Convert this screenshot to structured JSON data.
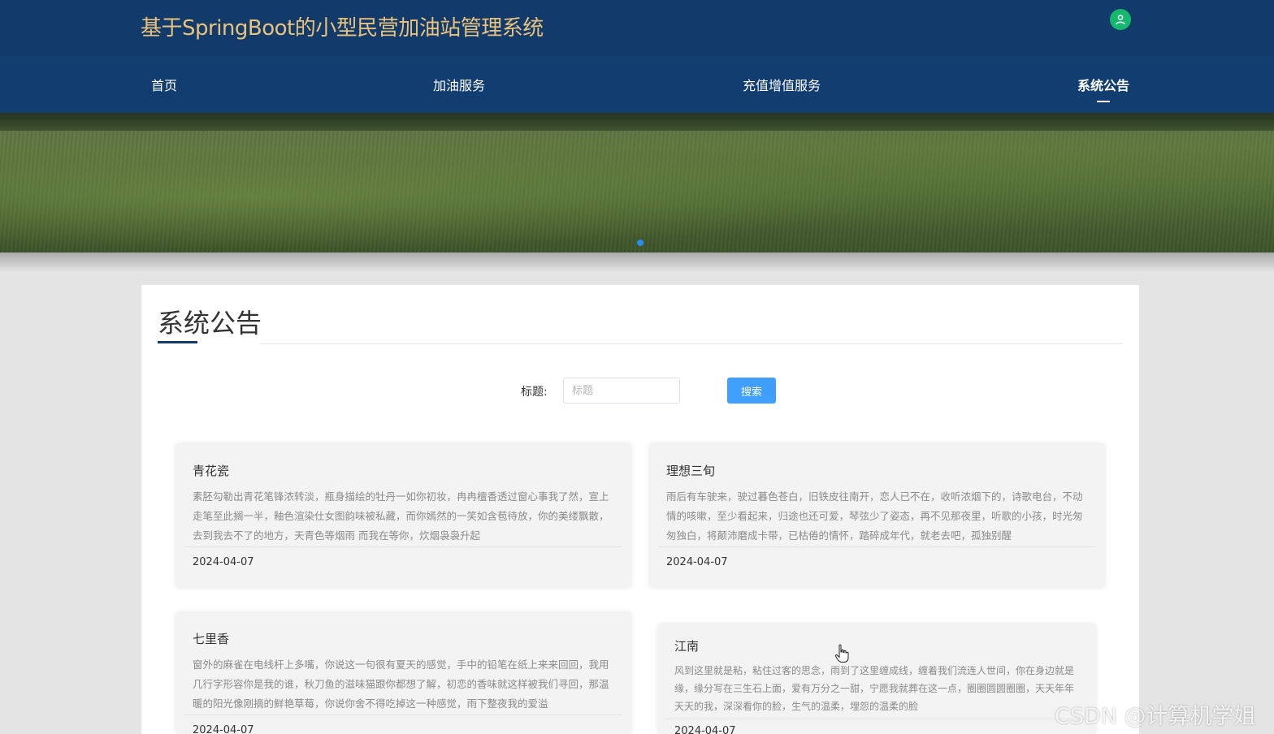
{
  "header": {
    "site_title": "基于SpringBoot的小型民营加油站管理系统",
    "user_icon": "user-icon"
  },
  "nav": {
    "items": [
      {
        "label": "首页"
      },
      {
        "label": "加油服务"
      },
      {
        "label": "充值增值服务"
      },
      {
        "label": "系统公告",
        "active": true
      }
    ]
  },
  "banner": {
    "active_slide": 1
  },
  "main": {
    "title": "系统公告",
    "search": {
      "label": "标题:",
      "placeholder": "标题",
      "value": "",
      "button_label": "搜索"
    },
    "cards": [
      {
        "title": "青花瓷",
        "body": "素胚勾勒出青花笔锋浓转淡，瓶身描绘的牡丹一如你初妆，冉冉檀香透过窗心事我了然，宣上走笔至此搁一半，釉色渲染仕女图韵味被私藏，而你嫣然的一笑如含苞待放，你的美缕飘散，去到我去不了的地方，天青色等烟雨 而我在等你，炊烟袅袅升起",
        "date": "2024-04-07"
      },
      {
        "title": "理想三旬",
        "body": "雨后有车驶来，驶过暮色苍白，旧铁皮往南开，恋人已不在，收听浓烟下的，诗歌电台，不动情的咳嗽，至少看起来，归途也还可爱，琴弦少了姿态，再不见那夜里，听歌的小孩，时光匆匆独白，将颠沛磨成卡带，已枯倦的情怀，踏碎成年代，就老去吧，孤独别醒",
        "date": "2024-04-07"
      },
      {
        "title": "七里香",
        "body": "窗外的麻雀在电线杆上多嘴，你说这一句很有夏天的感觉，手中的铅笔在纸上来来回回，我用几行字形容你是我的谁，秋刀鱼的滋味猫跟你都想了解，初恋的香味就这样被我们寻回，那温暖的阳光像刚摘的鲜艳草莓，你说你舍不得吃掉这一种感觉，雨下整夜我的爱溢",
        "date": "2024-04-07"
      },
      {
        "title": "江南",
        "body": "风到这里就是粘，粘住过客的思念，雨到了这里缠成线，缠着我们流连人世间，你在身边就是缘，缘分写在三生石上面，爱有万分之一甜，宁愿我就葬在这一点，圈圈圆圆圈圈，天天年年天天的我，深深看你的脸，生气的温柔，埋怨的温柔的脸",
        "date": "2024-04-07"
      }
    ]
  },
  "watermark": "CSDN @计算机学姐"
}
